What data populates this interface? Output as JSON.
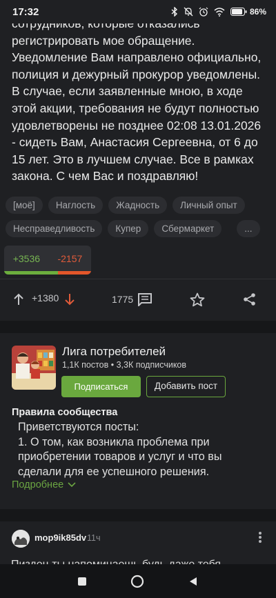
{
  "status_bar": {
    "time": "17:32",
    "battery": "86"
  },
  "post": {
    "text": "сотрудников, которые отказались регистрировать мое обращение. Уведомление Вам направлено официально, полиция и дежурный прокурор уведомлены. В случае, если заявленные мною, в ходе этой акции, требования не будут полностью удовлетворены не позднее 02:08 13.01.2026 - сидеть Вам, Анастасия Сергеевна, от 6 до 15 лет. Это в лучшем случае. Все в рамках закона. С чем Вас и поздравляю!",
    "tags": [
      "[моё]",
      "Наглость",
      "Жадность",
      "Личный опыт",
      "Несправедливость",
      "Купер",
      "Сбермаркет",
      "..."
    ],
    "rating_popup": {
      "plus": "+3536",
      "minus": "-2157",
      "positive_share": 0.62
    },
    "rating": "+1380",
    "comments_count": "1775"
  },
  "community": {
    "title": "Лига потребителей",
    "stats": "1,1К постов • 3,3К подписчиков",
    "subscribe_label": "Подписаться",
    "add_post_label": "Добавить пост",
    "rules_title": "Правила сообщества",
    "rules_text": "Приветствуются посты:\n1. О том, как возникла проблема при приобретении товаров и услуг и что вы сделали для ее успешного решения.",
    "more_label": "Подробнее"
  },
  "comment": {
    "author": "mop9ik85dv",
    "time": "11ч",
    "text": "Пиздец ты напоминаешь будь даже тебя"
  },
  "colors": {
    "accent_green": "#6aa83e",
    "minus_red": "#e3562a",
    "background": "#1f2023"
  }
}
